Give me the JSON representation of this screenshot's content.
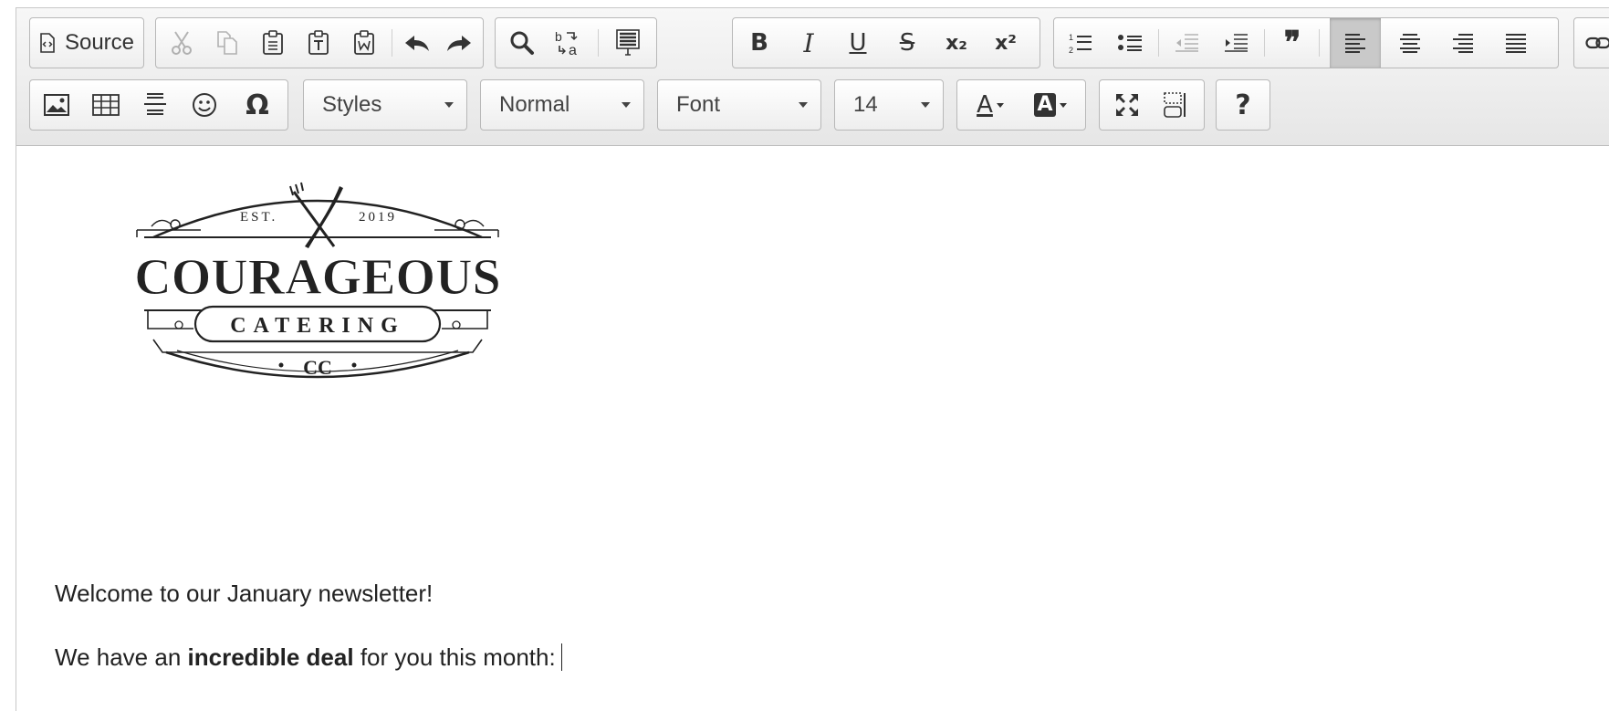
{
  "toolbar": {
    "source_label": "Source",
    "styles_label": "Styles",
    "format_label": "Normal",
    "font_label": "Font",
    "size_label": "14",
    "help_label": "?"
  },
  "icons": {
    "cut": "scissors-icon",
    "copy": "copy-icon",
    "paste": "paste-icon",
    "paste_text": "paste-text-icon",
    "paste_word": "paste-word-icon",
    "undo": "undo-icon",
    "redo": "redo-icon",
    "find": "search-icon",
    "replace": "replace-icon",
    "select_all": "select-all-icon",
    "bold": "B",
    "italic": "I",
    "underline": "U",
    "strike": "S",
    "subscript": "x₂",
    "superscript": "x²",
    "numbered_list": "numbered-list-icon",
    "bulleted_list": "bulleted-list-icon",
    "outdent": "outdent-icon",
    "indent": "indent-icon",
    "blockquote": "❞",
    "align_left": "align-left-icon",
    "align_center": "align-center-icon",
    "align_right": "align-right-icon",
    "justify": "justify-icon",
    "link": "link-icon",
    "image": "image-icon",
    "table": "table-icon",
    "horizontal_line": "horizontal-line-icon",
    "smiley": "smiley-icon",
    "special_char": "Ω",
    "text_color": "A",
    "bg_color": "A",
    "maximize": "maximize-icon",
    "show_blocks": "show-blocks-icon"
  },
  "logo": {
    "est": "EST.",
    "year": "2019",
    "name": "COURAGEOUS",
    "sub": "CATERING",
    "monogram": "CC"
  },
  "content": {
    "line1": "Welcome to our January newsletter!",
    "line2_pre": "We have an ",
    "line2_bold": "incredible deal",
    "line2_post": " for you this month:"
  },
  "colors": {
    "toolbar_bg": "#ececec",
    "active_button": "#c9c9c9"
  }
}
